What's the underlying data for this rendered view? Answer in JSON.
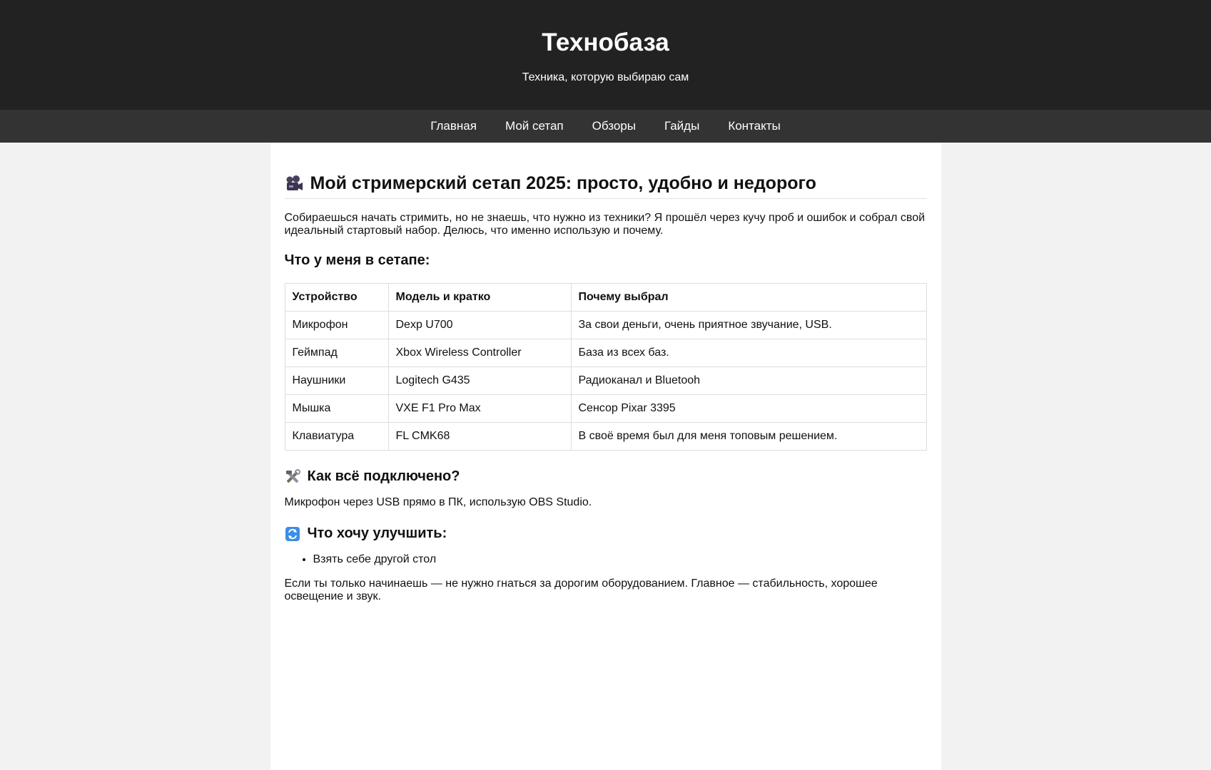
{
  "site": {
    "title": "Технобаза",
    "tagline": "Техника, которую выбираю сам"
  },
  "nav": {
    "items": [
      "Главная",
      "Мой сетап",
      "Обзоры",
      "Гайды",
      "Контакты"
    ]
  },
  "article": {
    "title": "Мой стримерский сетап 2025: просто, удобно и недорого",
    "title_icon": "video-camera-icon",
    "intro": "Собираешься начать стримить, но не знаешь, что нужно из техники? Я прошёл через кучу проб и ошибок и собрал свой идеальный стартовый набор. Делюсь, что именно использую и почему.",
    "setup_heading": "Что у меня в сетапе:",
    "table": {
      "headers": [
        "Устройство",
        "Модель и кратко",
        "Почему выбрал"
      ],
      "rows": [
        [
          "Микрофон",
          "Dexp U700",
          "За свои деньги, очень приятное звучание, USB."
        ],
        [
          "Геймпад",
          "Xbox Wireless Controller",
          "База из всех баз."
        ],
        [
          "Наушники",
          "Logitech G435",
          "Радиоканал и Bluetooh"
        ],
        [
          "Мышка",
          "VXE F1 Pro Max",
          "Сенсор Pixar 3395"
        ],
        [
          "Клавиатура",
          "FL CMK68",
          "В своё время был для меня топовым решением."
        ]
      ]
    },
    "connect_heading": "Как всё подключено?",
    "connect_icon": "hammer-wrench-icon",
    "connect_text": "Микрофон через USB прямо в ПК, использую OBS Studio.",
    "improve_heading": "Что хочу улучшить:",
    "improve_icon": "refresh-icon",
    "improve_items": [
      "Взять себе другой стол"
    ],
    "outro": "Если ты только начинаешь — не нужно гнаться за дорогим оборудованием. Главное — стабильность, хорошее освещение и звук."
  },
  "colors": {
    "header_bg": "#222222",
    "nav_bg": "#333333",
    "page_bg": "#f2f2f2",
    "content_bg": "#ffffff"
  }
}
